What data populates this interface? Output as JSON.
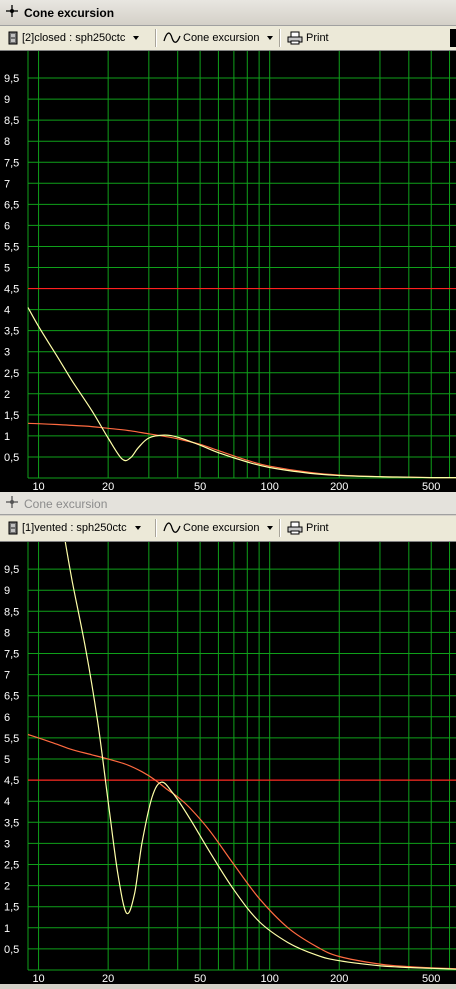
{
  "windows": [
    {
      "title": "Cone excursion",
      "toolbar": {
        "source": "[2]closed : sph250ctc",
        "view": "Cone excursion",
        "print": "Print"
      },
      "chart_data": {
        "type": "line",
        "xscale": "log",
        "xlim": [
          9,
          640
        ],
        "ylim": [
          0,
          10
        ],
        "xticks": [
          "10",
          "20",
          "50",
          "100",
          "200",
          "500"
        ],
        "yticks": [
          "0,5",
          "1",
          "1,5",
          "2",
          "2,5",
          "3",
          "3,5",
          "4",
          "4,5",
          "5",
          "5,5",
          "6",
          "6,5",
          "7",
          "7,5",
          "8",
          "8,5",
          "9",
          "9,5"
        ],
        "grid": true,
        "limit_line": {
          "y": 4.5,
          "color": "#ff2020"
        },
        "series": [
          {
            "color": "#ffffa8",
            "x": [
              9,
              10,
              12,
              14,
              17,
              20,
              23,
              25,
              27,
              30,
              35,
              40,
              50,
              60,
              80,
              100,
              150,
              200,
              300,
              400,
              500,
              640
            ],
            "values": [
              4.05,
              3.6,
              2.9,
              2.3,
              1.6,
              0.95,
              0.45,
              0.48,
              0.72,
              0.95,
              1.02,
              0.97,
              0.78,
              0.6,
              0.38,
              0.25,
              0.11,
              0.06,
              0.03,
              0.02,
              0.01,
              0.01
            ]
          },
          {
            "color": "#ff6a40",
            "x": [
              9,
              10,
              12,
              14,
              17,
              20,
              25,
              30,
              35,
              40,
              50,
              60,
              80,
              100,
              150,
              200,
              300,
              400,
              500,
              640
            ],
            "values": [
              1.3,
              1.29,
              1.27,
              1.25,
              1.22,
              1.18,
              1.12,
              1.05,
              0.99,
              0.93,
              0.8,
              0.65,
              0.42,
              0.28,
              0.13,
              0.07,
              0.03,
              0.02,
              0.01,
              0.01
            ]
          }
        ]
      }
    },
    {
      "title": "Cone excursion",
      "toolbar": {
        "source": "[1]vented : sph250ctc",
        "view": "Cone excursion",
        "print": "Print"
      },
      "chart_data": {
        "type": "line",
        "xscale": "log",
        "xlim": [
          9,
          640
        ],
        "ylim": [
          0,
          10
        ],
        "xticks": [
          "10",
          "20",
          "50",
          "100",
          "200",
          "500"
        ],
        "yticks": [
          "0,5",
          "1",
          "1,5",
          "2",
          "2,5",
          "3",
          "3,5",
          "4",
          "4,5",
          "5",
          "5,5",
          "6",
          "6,5",
          "7",
          "7,5",
          "8",
          "8,5",
          "9",
          "9,5"
        ],
        "grid": true,
        "limit_line": {
          "y": 4.5,
          "color": "#ff2020"
        },
        "series": [
          {
            "color": "#ffffa8",
            "x": [
              13,
              14,
              16,
              18,
              20,
              22,
              24,
              26,
              28,
              31,
              34,
              38,
              45,
              55,
              70,
              90,
              120,
              160,
              200,
              300,
              400,
              500,
              640
            ],
            "values": [
              10.2,
              9.2,
              7.6,
              5.9,
              4.0,
              2.3,
              1.35,
              1.8,
              3.0,
              4.1,
              4.45,
              4.2,
              3.6,
              2.8,
              1.9,
              1.15,
              0.65,
              0.35,
              0.22,
              0.1,
              0.06,
              0.04,
              0.02
            ]
          },
          {
            "color": "#ff6a40",
            "x": [
              9,
              10,
              12,
              14,
              17,
              20,
              24,
              28,
              32,
              36,
              40,
              45,
              55,
              70,
              90,
              120,
              160,
              200,
              300,
              400,
              500,
              640
            ],
            "values": [
              5.58,
              5.5,
              5.35,
              5.22,
              5.1,
              5.0,
              4.87,
              4.7,
              4.5,
              4.28,
              4.1,
              3.85,
              3.3,
              2.5,
              1.7,
              1.0,
              0.55,
              0.32,
              0.14,
              0.08,
              0.05,
              0.03
            ]
          }
        ]
      }
    }
  ]
}
